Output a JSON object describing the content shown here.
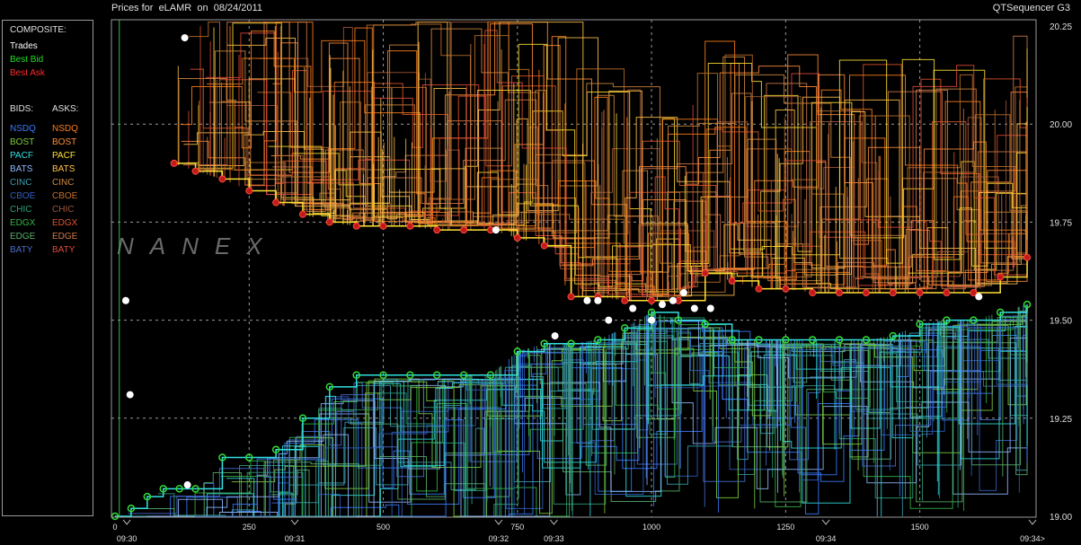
{
  "header": {
    "title_left": "Prices for  eLAMR  on  08/24/2011",
    "title_right": "QTSequencer G3"
  },
  "legend": {
    "composite_label": "COMPOSITE:",
    "composite_items": [
      {
        "label": "Trades",
        "color": "#ffffff"
      },
      {
        "label": "Best Bid",
        "color": "#22dd22"
      },
      {
        "label": "Best Ask",
        "color": "#ff2a2a"
      }
    ],
    "bids_label": "BIDS:",
    "asks_label": "ASKS:",
    "exchanges": [
      {
        "bid": "NSDQ",
        "ask": "NSDQ",
        "bid_color": "#3a7bff",
        "ask_color": "#ff7f1a"
      },
      {
        "bid": "BOST",
        "ask": "BOST",
        "bid_color": "#7fcf3f",
        "ask_color": "#ff8c3a"
      },
      {
        "bid": "PACF",
        "ask": "PACF",
        "bid_color": "#33e0e0",
        "ask_color": "#ffe033"
      },
      {
        "bid": "BATS",
        "ask": "BATS",
        "bid_color": "#8fb8ff",
        "ask_color": "#ffc24a"
      },
      {
        "bid": "CINC",
        "ask": "CINC",
        "bid_color": "#3aa0b0",
        "ask_color": "#d08a40"
      },
      {
        "bid": "CBOE",
        "ask": "CBOE",
        "bid_color": "#2f5fbf",
        "ask_color": "#c0702a"
      },
      {
        "bid": "CHIC",
        "ask": "CHIC",
        "bid_color": "#2fa07a",
        "ask_color": "#a0583a"
      },
      {
        "bid": "EDGX",
        "ask": "EDGX",
        "bid_color": "#33b544",
        "ask_color": "#e0542a"
      },
      {
        "bid": "EDGE",
        "ask": "EDGE",
        "bid_color": "#5ab06a",
        "ask_color": "#d07a4a"
      },
      {
        "bid": "BATY",
        "ask": "BATY",
        "bid_color": "#4a6fd0",
        "ask_color": "#e04a3a"
      }
    ]
  },
  "watermark": "NANEX",
  "chart_data": {
    "type": "line",
    "ylim": [
      19.0,
      20.25
    ],
    "xlim": [
      0,
      1710
    ],
    "y_ticks": [
      "20.25",
      "20.00",
      "19.75",
      "19.50",
      "19.25",
      "19.00"
    ],
    "y_tick_values": [
      20.25,
      20.0,
      19.75,
      19.5,
      19.25,
      19.0
    ],
    "x_ticks": [
      "0",
      "250",
      "500",
      "750",
      "1000",
      "1250",
      "1500"
    ],
    "x_tick_values": [
      0,
      250,
      500,
      750,
      1000,
      1250,
      1500
    ],
    "time_labels": [
      {
        "label": "09:30",
        "x": 22
      },
      {
        "label": "09:31",
        "x": 335
      },
      {
        "label": "09:32",
        "x": 715
      },
      {
        "label": "09:33",
        "x": 818
      },
      {
        "label": "09:34",
        "x": 1325
      },
      {
        "label": "09:34>",
        "x": 1710
      }
    ],
    "grid": true,
    "series": [
      {
        "name": "Best Ask",
        "color": "#ff2a2a",
        "x": [
          110,
          150,
          200,
          250,
          300,
          350,
          400,
          450,
          500,
          550,
          600,
          650,
          700,
          750,
          800,
          850,
          900,
          950,
          1000,
          1050,
          1100,
          1150,
          1200,
          1250,
          1300,
          1350,
          1400,
          1450,
          1500,
          1550,
          1600,
          1650,
          1700
        ],
        "y": [
          19.9,
          19.88,
          19.86,
          19.83,
          19.8,
          19.77,
          19.75,
          19.74,
          19.74,
          19.74,
          19.73,
          19.73,
          19.73,
          19.71,
          19.69,
          19.56,
          19.56,
          19.55,
          19.55,
          19.55,
          19.62,
          19.6,
          19.58,
          19.58,
          19.57,
          19.57,
          19.57,
          19.57,
          19.57,
          19.57,
          19.57,
          19.61,
          19.66
        ]
      },
      {
        "name": "Best Bid",
        "color": "#22dd22",
        "x": [
          0,
          30,
          60,
          90,
          120,
          150,
          200,
          250,
          300,
          350,
          400,
          450,
          500,
          550,
          600,
          650,
          700,
          750,
          800,
          850,
          900,
          950,
          1000,
          1050,
          1100,
          1150,
          1200,
          1250,
          1300,
          1350,
          1400,
          1450,
          1500,
          1550,
          1600,
          1650,
          1700
        ],
        "y": [
          19.0,
          19.02,
          19.05,
          19.07,
          19.07,
          19.07,
          19.15,
          19.15,
          19.17,
          19.25,
          19.33,
          19.36,
          19.36,
          19.36,
          19.36,
          19.36,
          19.36,
          19.42,
          19.44,
          19.44,
          19.45,
          19.48,
          19.52,
          19.5,
          19.49,
          19.45,
          19.45,
          19.45,
          19.45,
          19.45,
          19.45,
          19.46,
          19.49,
          19.5,
          19.5,
          19.52,
          19.54
        ]
      },
      {
        "name": "Trades",
        "color": "#ffffff",
        "x": [
          20,
          28,
          130,
          135,
          710,
          820,
          880,
          900,
          920,
          965,
          1000,
          1020,
          1040,
          1060,
          1080,
          1110,
          1610
        ],
        "y": [
          19.55,
          19.31,
          20.22,
          19.08,
          19.73,
          19.46,
          19.55,
          19.55,
          19.5,
          19.53,
          19.5,
          19.54,
          19.55,
          19.57,
          19.53,
          19.53,
          19.56
        ]
      }
    ]
  }
}
